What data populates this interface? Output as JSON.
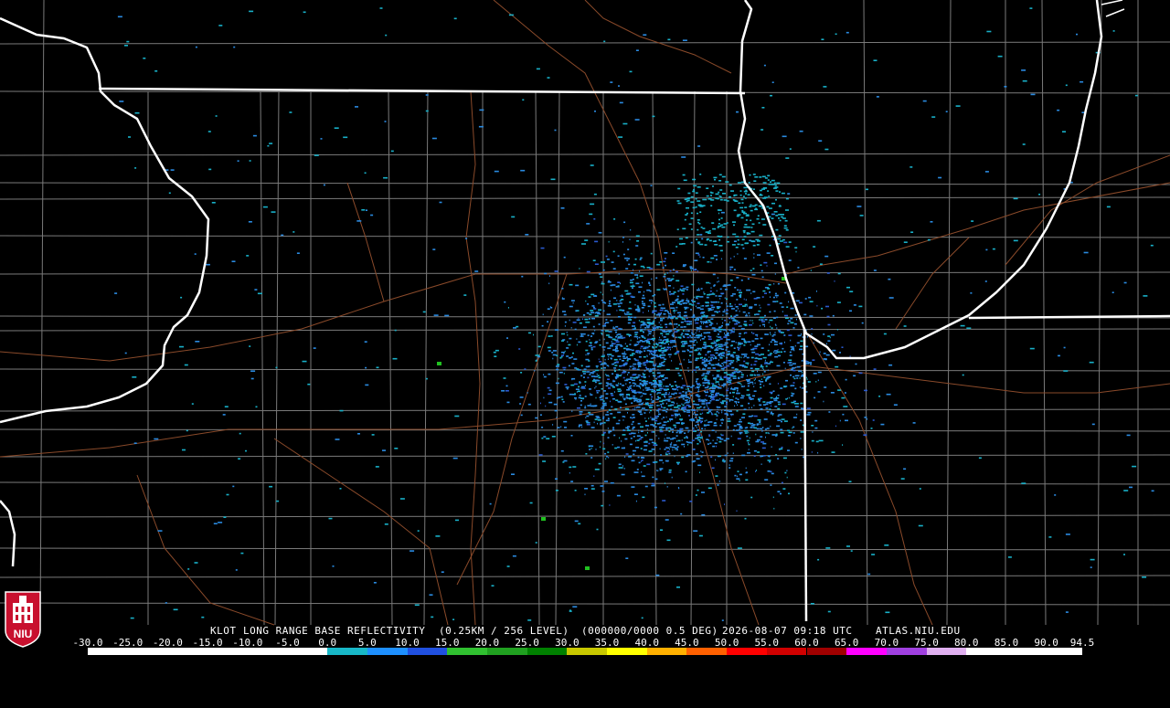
{
  "product": {
    "radar_id": "KLOT",
    "product_name": "LONG RANGE BASE REFLECTIVITY",
    "resolution": "(0.25KM / 256 LEVEL)",
    "scan_info": "(000000/0000 0.5 DEG)",
    "datetime": "2026-08-07 09:18 UTC",
    "source": "ATLAS.NIU.EDU"
  },
  "logo": {
    "text": "NIU",
    "color": "#c8102e"
  },
  "colorbar": {
    "labels": [
      "-30.0",
      "-25.0",
      "-20.0",
      "-15.0",
      "-10.0",
      "-5.0",
      "0.0",
      "5.0",
      "10.0",
      "15.0",
      "20.0",
      "25.0",
      "30.0",
      "35.0",
      "40.0",
      "45.0",
      "50.0",
      "55.0",
      "60.0",
      "65.0",
      "70.0",
      "75.0",
      "80.0",
      "85.0",
      "90.0",
      "94.5"
    ],
    "segments": [
      {
        "from": -30,
        "to": 0,
        "color": "#ffffff"
      },
      {
        "from": 0,
        "to": 5,
        "color": "#18b8c8"
      },
      {
        "from": 5,
        "to": 10,
        "color": "#1e90ff"
      },
      {
        "from": 10,
        "to": 15,
        "color": "#2050e0"
      },
      {
        "from": 15,
        "to": 20,
        "color": "#30c030"
      },
      {
        "from": 20,
        "to": 25,
        "color": "#20a020"
      },
      {
        "from": 25,
        "to": 30,
        "color": "#008000"
      },
      {
        "from": 30,
        "to": 35,
        "color": "#c8c800"
      },
      {
        "from": 35,
        "to": 40,
        "color": "#ffff00"
      },
      {
        "from": 40,
        "to": 45,
        "color": "#ffb000"
      },
      {
        "from": 45,
        "to": 50,
        "color": "#ff6000"
      },
      {
        "from": 50,
        "to": 55,
        "color": "#ff0000"
      },
      {
        "from": 55,
        "to": 60,
        "color": "#d00000"
      },
      {
        "from": 60,
        "to": 65,
        "color": "#a00000"
      },
      {
        "from": 65,
        "to": 70,
        "color": "#ff00ff"
      },
      {
        "from": 70,
        "to": 75,
        "color": "#a040e0"
      },
      {
        "from": 75,
        "to": 80,
        "color": "#e0b0f0"
      },
      {
        "from": 80,
        "to": 94.5,
        "color": "#ffffff"
      }
    ]
  },
  "colors": {
    "background": "#000000",
    "state_border": "#ffffff",
    "county_line": "#7a7a7a",
    "highway": "#8a4a2a",
    "echo_low": "#18b0c8",
    "echo_mid": "#2a8ae0",
    "echo_high": "#2a5ad0",
    "echo_green": "#20c020"
  }
}
